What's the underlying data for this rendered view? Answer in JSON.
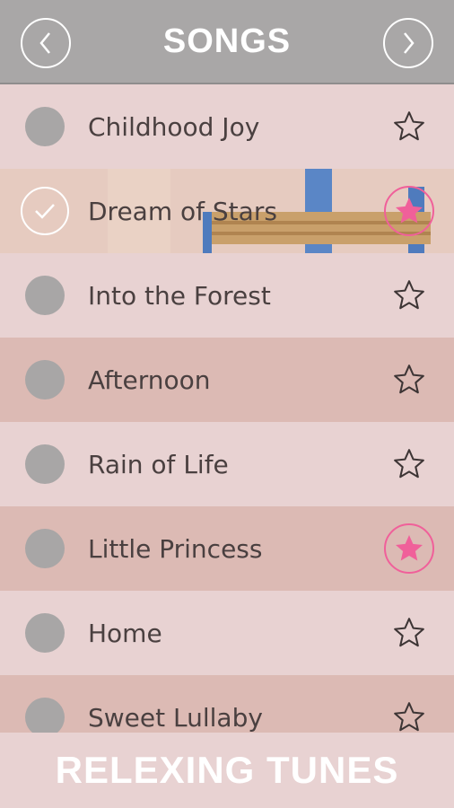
{
  "header": {
    "title": "SONGS",
    "prev_icon": "chevron-left-icon",
    "next_icon": "chevron-right-icon"
  },
  "songs": [
    {
      "title": "Childhood Joy",
      "checked": false,
      "favorite": false,
      "shade": "light"
    },
    {
      "title": "Dream of Stars",
      "checked": true,
      "favorite": true,
      "shade": "selected"
    },
    {
      "title": "Into the Forest",
      "checked": false,
      "favorite": false,
      "shade": "light"
    },
    {
      "title": "Afternoon",
      "checked": false,
      "favorite": false,
      "shade": "dark"
    },
    {
      "title": "Rain of Life",
      "checked": false,
      "favorite": false,
      "shade": "light"
    },
    {
      "title": "Little Princess",
      "checked": false,
      "favorite": true,
      "shade": "dark"
    },
    {
      "title": "Home",
      "checked": false,
      "favorite": false,
      "shade": "light"
    },
    {
      "title": "Sweet Lullaby",
      "checked": false,
      "favorite": false,
      "shade": "dark"
    }
  ],
  "footer": {
    "brand": "RELEXING TUNES"
  },
  "colors": {
    "header_bg": "#a9a7a7",
    "row_light": "#e8d2d2",
    "row_dark": "#dcbab4",
    "favorite_pink": "#f0609a",
    "text": "#4a4040"
  }
}
